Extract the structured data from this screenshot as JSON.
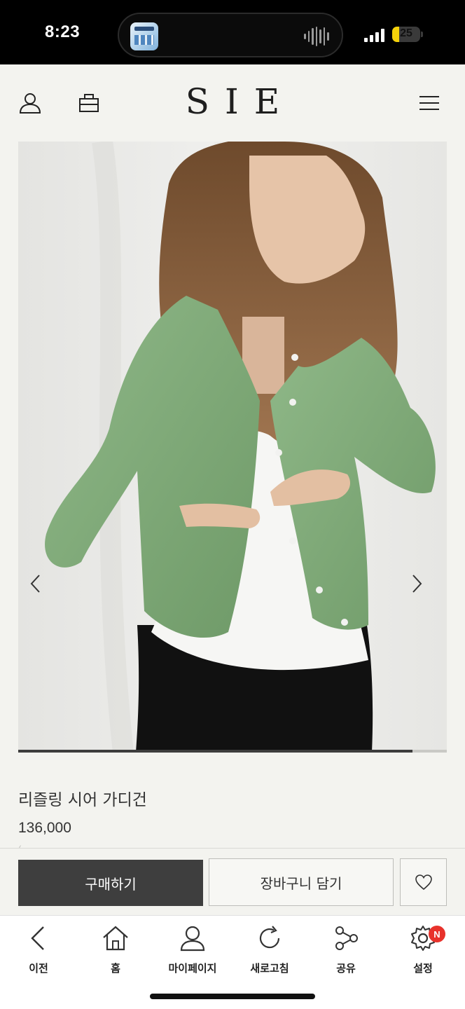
{
  "status_bar": {
    "time": "8:23",
    "battery": "25",
    "battery_level_percent": 25,
    "signal_icon": "cellular-signal-icon",
    "battery_icon": "battery-icon"
  },
  "header": {
    "logo": "SIE",
    "icons": [
      "user-icon",
      "shopping-bag-icon",
      "menu-icon"
    ]
  },
  "product": {
    "image_icon": "product-photo-green-cardigan",
    "name": "리즐링 시어 가디건",
    "price": "136,000",
    "price_secondary": "(",
    "carousel_progress_percent": 92,
    "prev_icon": "chevron-left-icon",
    "next_icon": "chevron-right-icon"
  },
  "purchase_bar": {
    "buy_label": "구매하기",
    "cart_label": "장바구니 담기",
    "wishlist_icon": "heart-icon"
  },
  "toolbar": {
    "items": [
      {
        "label": "이전",
        "icon": "back-arrow-icon"
      },
      {
        "label": "홈",
        "icon": "home-icon"
      },
      {
        "label": "마이페이지",
        "icon": "person-icon"
      },
      {
        "label": "새로고침",
        "icon": "refresh-icon"
      },
      {
        "label": "공유",
        "icon": "share-icon"
      },
      {
        "label": "설정",
        "icon": "settings-gear-icon"
      }
    ],
    "settings_badge": "N"
  },
  "colors": {
    "background": "#f3f3ef",
    "buy_button": "#3e3e3e",
    "badge": "#e8322b",
    "battery": "#f5d20a"
  }
}
